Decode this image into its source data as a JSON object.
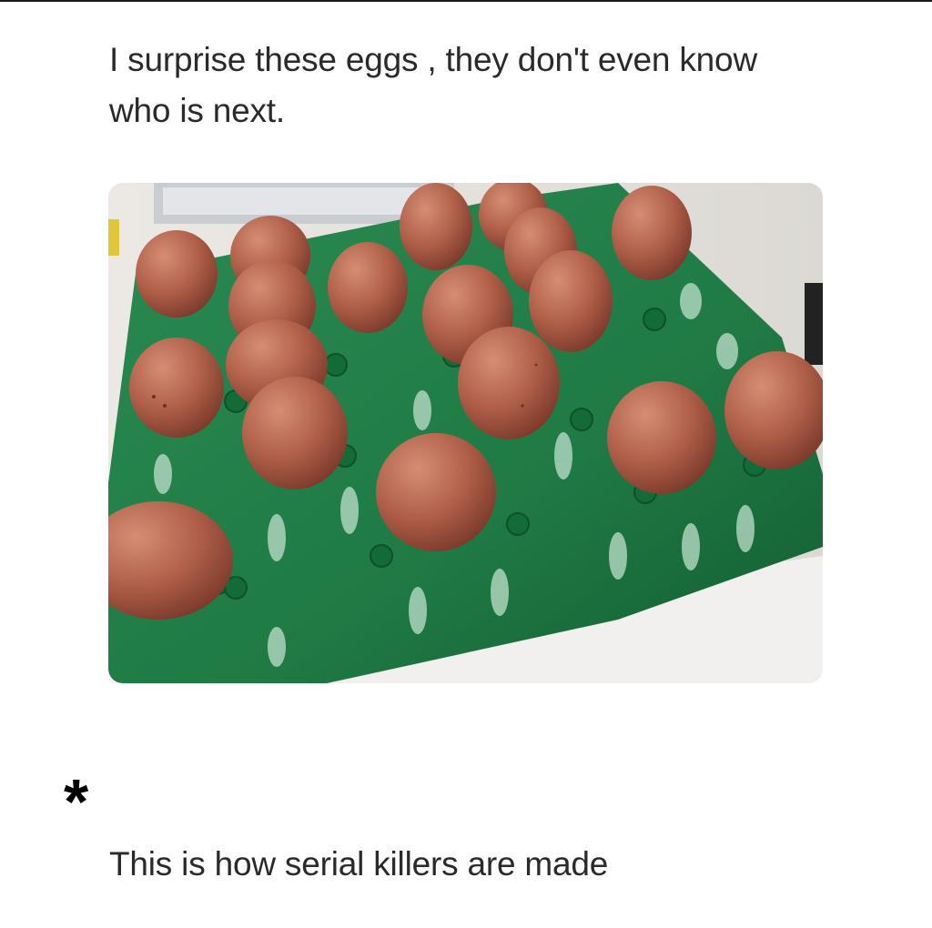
{
  "post": {
    "caption": "I surprise these eggs , they don't even know who is next.",
    "photo_subject": "brown-eggs-in-green-egg-tray",
    "colors": {
      "tray": "#1f7a44",
      "egg": "#b0604a",
      "background": "#ffffff"
    }
  },
  "annotation": {
    "marker": "*",
    "text": "This is how serial killers are made"
  },
  "icons": {
    "photo": "egg-tray-photo"
  }
}
